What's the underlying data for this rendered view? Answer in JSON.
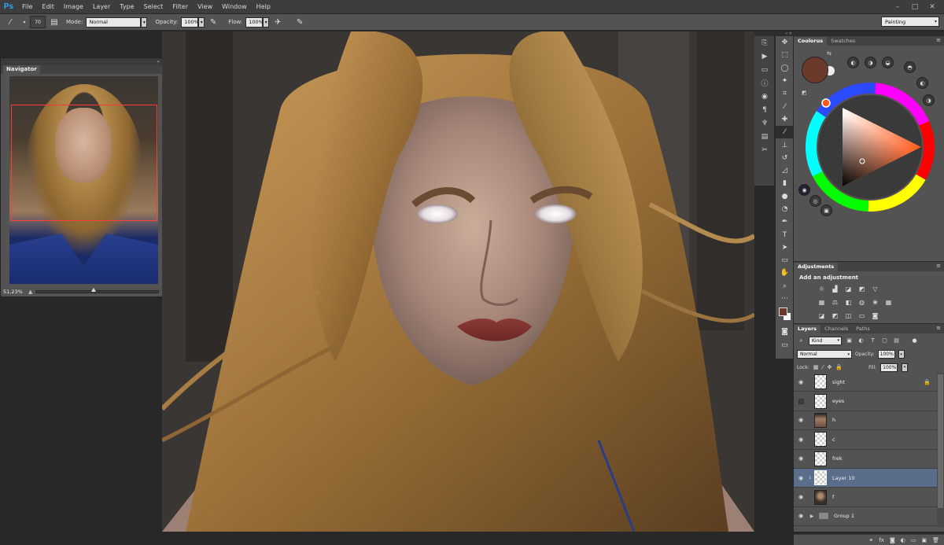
{
  "app": {
    "logo": "Ps"
  },
  "menu": [
    "File",
    "Edit",
    "Image",
    "Layer",
    "Type",
    "Select",
    "Filter",
    "View",
    "Window",
    "Help"
  ],
  "options": {
    "brush_size": "70",
    "mode_label": "Mode:",
    "mode_value": "Normal",
    "opacity_label": "Opacity:",
    "opacity_value": "100%",
    "flow_label": "Flow:",
    "flow_value": "100%",
    "workspace": "Painting"
  },
  "navigator": {
    "title": "Navigator",
    "zoom": "51,23%",
    "slider_fraction": 0.45
  },
  "coolorus": {
    "tabs": [
      "Coolorus",
      "Swatches"
    ],
    "current_color": "#6b3a2b"
  },
  "adjustments": {
    "tab": "Adjustments",
    "heading": "Add an adjustment"
  },
  "layers": {
    "tabs": [
      "Layers",
      "Channels",
      "Paths"
    ],
    "filter_kind": "Kind",
    "blend_mode": "Normal",
    "opacity_label": "Opacity:",
    "opacity_value": "100%",
    "lock_label": "Lock:",
    "fill_label": "Fill:",
    "fill_value": "100%",
    "items": [
      {
        "name": "sight",
        "visible": true,
        "locked": true
      },
      {
        "name": "eyes",
        "visible": false
      },
      {
        "name": "h",
        "visible": true
      },
      {
        "name": "c",
        "visible": true
      },
      {
        "name": "frek",
        "visible": true
      },
      {
        "name": "Layer 10",
        "visible": true,
        "selected": true
      },
      {
        "name": "f",
        "visible": true
      },
      {
        "name": "Group 1",
        "visible": true,
        "group": true
      }
    ]
  },
  "colors": {
    "foreground": "#6b3a2b",
    "background": "#ffffff",
    "selection": "#5a6e8c",
    "ps_blue": "#31a8ff"
  }
}
